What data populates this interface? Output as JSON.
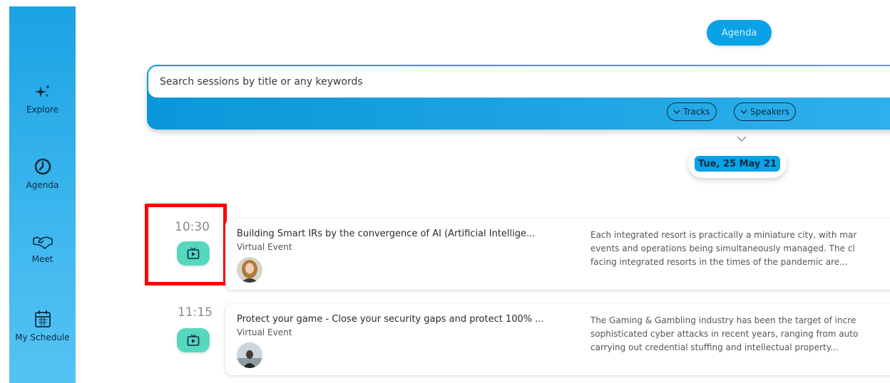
{
  "sidebar": {
    "items": [
      {
        "label": "Explore",
        "icon": "sparkle-icon"
      },
      {
        "label": "Agenda",
        "icon": "clock-icon"
      },
      {
        "label": "Meet",
        "icon": "handshake-icon"
      },
      {
        "label": "My Schedule",
        "icon": "calendar-icon"
      }
    ]
  },
  "header": {
    "agenda_label": "Agenda"
  },
  "search": {
    "placeholder": "Search sessions by title or any keywords"
  },
  "filters": {
    "tracks": "Tracks",
    "speakers": "Speakers"
  },
  "date": "Tue, 25 May 21",
  "sessions": [
    {
      "time": "10:30",
      "title": "Building Smart IRs by the convergence of AI (Artificial Intellige...",
      "type": "Virtual Event",
      "desc1": "Each integrated resort is practically a miniature city, with mar",
      "desc2": "events and operations being simultaneously managed. The cl",
      "desc3": "facing integrated resorts in the times of the pandemic are..."
    },
    {
      "time": "11:15",
      "title": "Protect your game - Close your security gaps and protect 100% ...",
      "type": "Virtual Event",
      "desc1": "The Gaming & Gambling industry has been the target of incre",
      "desc2": "sophisticated cyber attacks in recent years, ranging from auto",
      "desc3": "carrying out credential stuffing and intellectual property..."
    }
  ],
  "colors": {
    "sidebar": "#1aa3e3",
    "accent": "#0aa2e6",
    "tv_button": "#55d8be",
    "highlight": "#ff0000"
  }
}
